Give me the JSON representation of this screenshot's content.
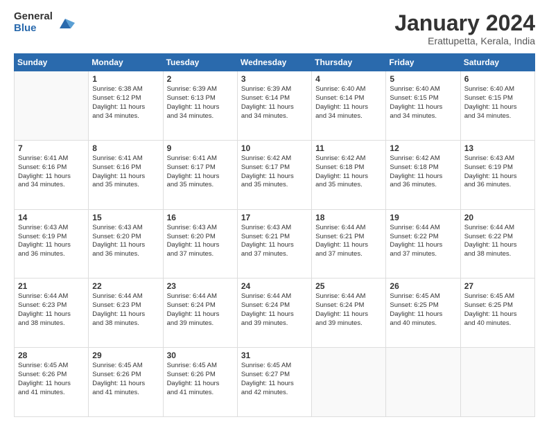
{
  "logo": {
    "general": "General",
    "blue": "Blue"
  },
  "title": "January 2024",
  "subtitle": "Erattupetta, Kerala, India",
  "days_of_week": [
    "Sunday",
    "Monday",
    "Tuesday",
    "Wednesday",
    "Thursday",
    "Friday",
    "Saturday"
  ],
  "weeks": [
    [
      {
        "day": "",
        "info": ""
      },
      {
        "day": "1",
        "info": "Sunrise: 6:38 AM\nSunset: 6:12 PM\nDaylight: 11 hours\nand 34 minutes."
      },
      {
        "day": "2",
        "info": "Sunrise: 6:39 AM\nSunset: 6:13 PM\nDaylight: 11 hours\nand 34 minutes."
      },
      {
        "day": "3",
        "info": "Sunrise: 6:39 AM\nSunset: 6:14 PM\nDaylight: 11 hours\nand 34 minutes."
      },
      {
        "day": "4",
        "info": "Sunrise: 6:40 AM\nSunset: 6:14 PM\nDaylight: 11 hours\nand 34 minutes."
      },
      {
        "day": "5",
        "info": "Sunrise: 6:40 AM\nSunset: 6:15 PM\nDaylight: 11 hours\nand 34 minutes."
      },
      {
        "day": "6",
        "info": "Sunrise: 6:40 AM\nSunset: 6:15 PM\nDaylight: 11 hours\nand 34 minutes."
      }
    ],
    [
      {
        "day": "7",
        "info": "Sunrise: 6:41 AM\nSunset: 6:16 PM\nDaylight: 11 hours\nand 34 minutes."
      },
      {
        "day": "8",
        "info": "Sunrise: 6:41 AM\nSunset: 6:16 PM\nDaylight: 11 hours\nand 35 minutes."
      },
      {
        "day": "9",
        "info": "Sunrise: 6:41 AM\nSunset: 6:17 PM\nDaylight: 11 hours\nand 35 minutes."
      },
      {
        "day": "10",
        "info": "Sunrise: 6:42 AM\nSunset: 6:17 PM\nDaylight: 11 hours\nand 35 minutes."
      },
      {
        "day": "11",
        "info": "Sunrise: 6:42 AM\nSunset: 6:18 PM\nDaylight: 11 hours\nand 35 minutes."
      },
      {
        "day": "12",
        "info": "Sunrise: 6:42 AM\nSunset: 6:18 PM\nDaylight: 11 hours\nand 36 minutes."
      },
      {
        "day": "13",
        "info": "Sunrise: 6:43 AM\nSunset: 6:19 PM\nDaylight: 11 hours\nand 36 minutes."
      }
    ],
    [
      {
        "day": "14",
        "info": "Sunrise: 6:43 AM\nSunset: 6:19 PM\nDaylight: 11 hours\nand 36 minutes."
      },
      {
        "day": "15",
        "info": "Sunrise: 6:43 AM\nSunset: 6:20 PM\nDaylight: 11 hours\nand 36 minutes."
      },
      {
        "day": "16",
        "info": "Sunrise: 6:43 AM\nSunset: 6:20 PM\nDaylight: 11 hours\nand 37 minutes."
      },
      {
        "day": "17",
        "info": "Sunrise: 6:43 AM\nSunset: 6:21 PM\nDaylight: 11 hours\nand 37 minutes."
      },
      {
        "day": "18",
        "info": "Sunrise: 6:44 AM\nSunset: 6:21 PM\nDaylight: 11 hours\nand 37 minutes."
      },
      {
        "day": "19",
        "info": "Sunrise: 6:44 AM\nSunset: 6:22 PM\nDaylight: 11 hours\nand 37 minutes."
      },
      {
        "day": "20",
        "info": "Sunrise: 6:44 AM\nSunset: 6:22 PM\nDaylight: 11 hours\nand 38 minutes."
      }
    ],
    [
      {
        "day": "21",
        "info": "Sunrise: 6:44 AM\nSunset: 6:23 PM\nDaylight: 11 hours\nand 38 minutes."
      },
      {
        "day": "22",
        "info": "Sunrise: 6:44 AM\nSunset: 6:23 PM\nDaylight: 11 hours\nand 38 minutes."
      },
      {
        "day": "23",
        "info": "Sunrise: 6:44 AM\nSunset: 6:24 PM\nDaylight: 11 hours\nand 39 minutes."
      },
      {
        "day": "24",
        "info": "Sunrise: 6:44 AM\nSunset: 6:24 PM\nDaylight: 11 hours\nand 39 minutes."
      },
      {
        "day": "25",
        "info": "Sunrise: 6:44 AM\nSunset: 6:24 PM\nDaylight: 11 hours\nand 39 minutes."
      },
      {
        "day": "26",
        "info": "Sunrise: 6:45 AM\nSunset: 6:25 PM\nDaylight: 11 hours\nand 40 minutes."
      },
      {
        "day": "27",
        "info": "Sunrise: 6:45 AM\nSunset: 6:25 PM\nDaylight: 11 hours\nand 40 minutes."
      }
    ],
    [
      {
        "day": "28",
        "info": "Sunrise: 6:45 AM\nSunset: 6:26 PM\nDaylight: 11 hours\nand 41 minutes."
      },
      {
        "day": "29",
        "info": "Sunrise: 6:45 AM\nSunset: 6:26 PM\nDaylight: 11 hours\nand 41 minutes."
      },
      {
        "day": "30",
        "info": "Sunrise: 6:45 AM\nSunset: 6:26 PM\nDaylight: 11 hours\nand 41 minutes."
      },
      {
        "day": "31",
        "info": "Sunrise: 6:45 AM\nSunset: 6:27 PM\nDaylight: 11 hours\nand 42 minutes."
      },
      {
        "day": "",
        "info": ""
      },
      {
        "day": "",
        "info": ""
      },
      {
        "day": "",
        "info": ""
      }
    ]
  ]
}
